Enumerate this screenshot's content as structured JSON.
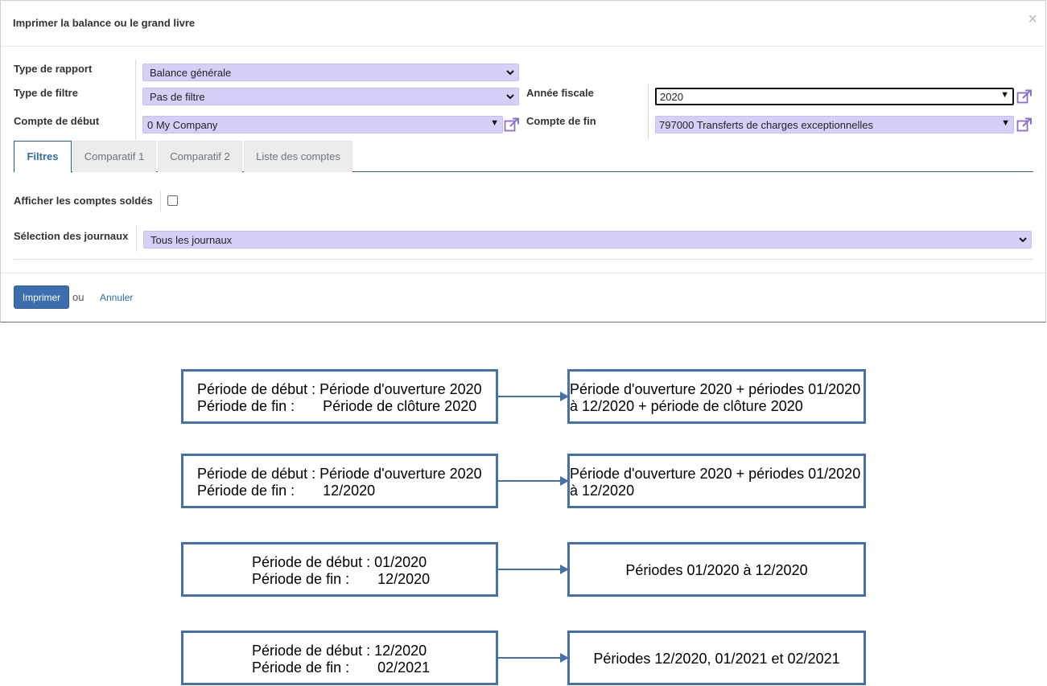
{
  "dialog": {
    "title": "Imprimer la balance ou le grand livre",
    "close_glyph": "×"
  },
  "form": {
    "report_type_label": "Type de rapport",
    "report_type_value": "Balance générale",
    "filter_type_label": "Type de filtre",
    "filter_type_value": "Pas de filtre",
    "fiscal_year_label": "Année fiscale",
    "fiscal_year_value": "2020",
    "start_account_label": "Compte de début",
    "start_account_value": "0 My Company",
    "end_account_label": "Compte de fin",
    "end_account_value": "797000 Transferts de charges exceptionnelles"
  },
  "tabs": [
    {
      "label": "Filtres",
      "active": true
    },
    {
      "label": "Comparatif 1",
      "active": false
    },
    {
      "label": "Comparatif 2",
      "active": false
    },
    {
      "label": "Liste des comptes",
      "active": false
    }
  ],
  "filters": {
    "show_settled_label": "Afficher les comptes soldés",
    "show_settled_checked": false,
    "journals_label": "Sélection des journaux",
    "journals_value": "Tous les journaux"
  },
  "footer": {
    "print_label": "Imprimer",
    "or_label": "ou",
    "cancel_label": "Annuler"
  },
  "diagram": {
    "rows": [
      {
        "left": [
          "Période de début : Période d'ouverture 2020",
          "Période de fin :       Période de clôture 2020"
        ],
        "right": [
          "Période d'ouverture 2020 + périodes 01/2020",
          "à 12/2020 + période de clôture 2020"
        ]
      },
      {
        "left": [
          "Période de début : Période d'ouverture 2020",
          "Période de fin :       12/2020"
        ],
        "right": [
          "Période d'ouverture 2020 + périodes 01/2020",
          "à 12/2020"
        ]
      },
      {
        "left": [
          "Période de début : 01/2020",
          "Période de fin :       12/2020"
        ],
        "right": [
          "Périodes 01/2020 à 12/2020"
        ]
      },
      {
        "left": [
          "Période de début : 12/2020",
          "Période de fin :       02/2021"
        ],
        "right": [
          "Périodes 12/2020, 01/2021 et 02/2021"
        ]
      }
    ]
  },
  "colors": {
    "select_bg": "#d7cff8",
    "accent": "#2e6da4",
    "diagram_border": "#4670a8",
    "link_icon": "#8a6fc9"
  }
}
